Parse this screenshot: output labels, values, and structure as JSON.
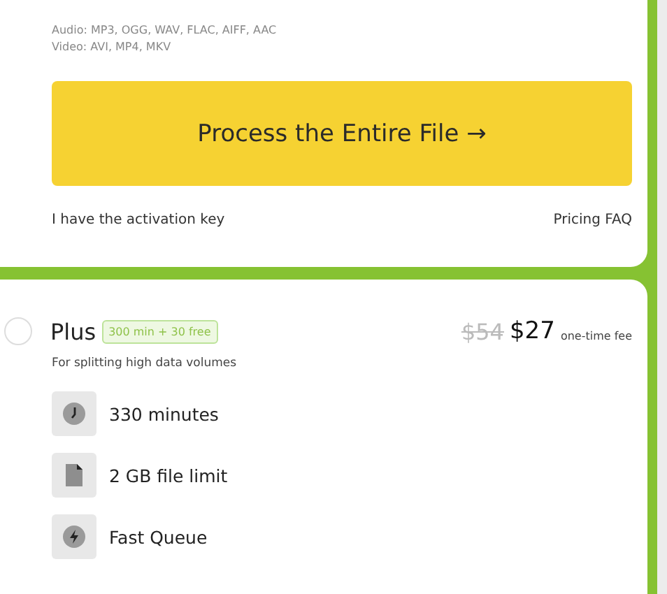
{
  "formats": [
    "Audio: MP3, OGG, WAV, FLAC, AIFF, AAC",
    "Video: AVI, MP4, MKV"
  ],
  "process_button": "Process the Entire File →",
  "links": {
    "left": "I have the activation key",
    "right": "Pricing FAQ"
  },
  "plan": {
    "selected": false,
    "name": "Plus",
    "badge": "300 min + 30 free",
    "old_price": "$54",
    "price": "$27",
    "price_note": "one-time fee",
    "description": "For splitting high data volumes",
    "features": [
      {
        "kind": "clock",
        "text": "330 minutes"
      },
      {
        "kind": "file",
        "text": "2 GB file limit"
      },
      {
        "kind": "bolt",
        "text": "Fast Queue"
      }
    ]
  }
}
